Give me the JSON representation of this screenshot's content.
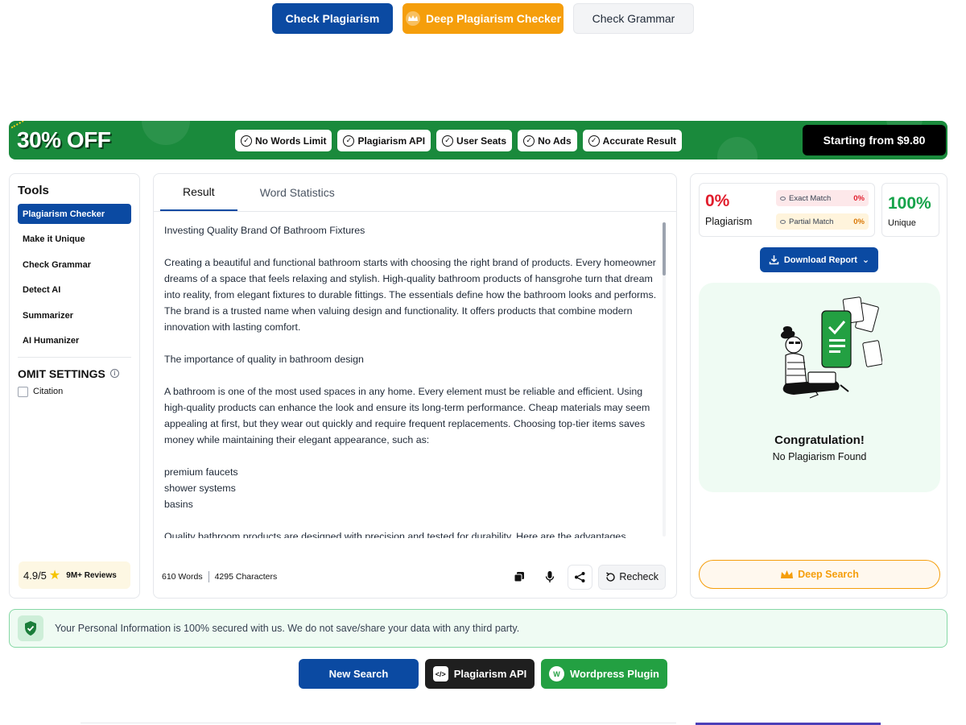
{
  "top_buttons": {
    "check_plagiarism": "Check Plagiarism",
    "deep_checker": "Deep Plagiarism Checker",
    "check_grammar": "Check Grammar"
  },
  "banner": {
    "discount": "30% OFF",
    "features": [
      "No Words Limit",
      "Plagiarism API",
      "User Seats",
      "No Ads",
      "Accurate Result"
    ],
    "starting_from": "Starting from $9.80",
    "color": "#1a8a3c"
  },
  "sidebar": {
    "title": "Tools",
    "items": [
      {
        "label": "Plagiarism Checker",
        "active": true
      },
      {
        "label": "Make it Unique",
        "active": false
      },
      {
        "label": "Check Grammar",
        "active": false
      },
      {
        "label": "Detect AI",
        "active": false
      },
      {
        "label": "Summarizer",
        "active": false
      },
      {
        "label": "AI Humanizer",
        "active": false
      }
    ],
    "omit_settings": "OMIT SETTINGS",
    "citation": "Citation",
    "rating_score": "4.9/5",
    "rating_reviews": "9M+ Reviews"
  },
  "main": {
    "tabs": [
      {
        "label": "Result",
        "active": true
      },
      {
        "label": "Word Statistics",
        "active": false
      }
    ],
    "paragraphs": [
      "Investing Quality Brand Of Bathroom Fixtures",
      "Creating a beautiful and functional bathroom starts with choosing the right brand of products. Every homeowner dreams of a space that feels relaxing and stylish. High-quality bathroom products of hansgrohe turn that dream into reality, from elegant fixtures to durable fittings. The essentials define how the bathroom looks and performs. The brand is a trusted name when valuing design and functionality. It offers products that combine modern innovation with lasting comfort.",
      "The importance of quality in bathroom design",
      "A bathroom is one of the most used spaces in any home. Every element must be reliable and efficient. Using high-quality products can enhance the look and ensure its long-term performance. Cheap materials may seem appealing at first, but they wear out quickly and require frequent replacements. Choosing top-tier items saves money while maintaining their elegant appearance, such as:",
      "premium faucets\nshower systems\nbasins",
      "Quality bathroom products are designed with precision and tested for durability. Here are the advantages"
    ],
    "word_count": "610 Words",
    "char_count": "4295 Characters",
    "recheck": "Recheck"
  },
  "result": {
    "plagiarism_pct": "0%",
    "plagiarism_label": "Plagiarism",
    "exact_match_label": "Exact Match",
    "exact_match_value": "0%",
    "partial_match_label": "Partial Match",
    "partial_match_value": "0%",
    "unique_pct": "100%",
    "unique_label": "Unique",
    "download_report": "Download Report",
    "congrats_title": "Congratulation!",
    "congrats_sub": "No Plagiarism Found",
    "deep_search": "Deep Search"
  },
  "secure": {
    "text": "Your Personal Information is 100% secured with us. We do not save/share your data with any third party."
  },
  "bottom_buttons": {
    "new_search": "New Search",
    "plagiarism_api": "Plagiarism API",
    "wordpress_plugin": "Wordpress Plugin"
  }
}
